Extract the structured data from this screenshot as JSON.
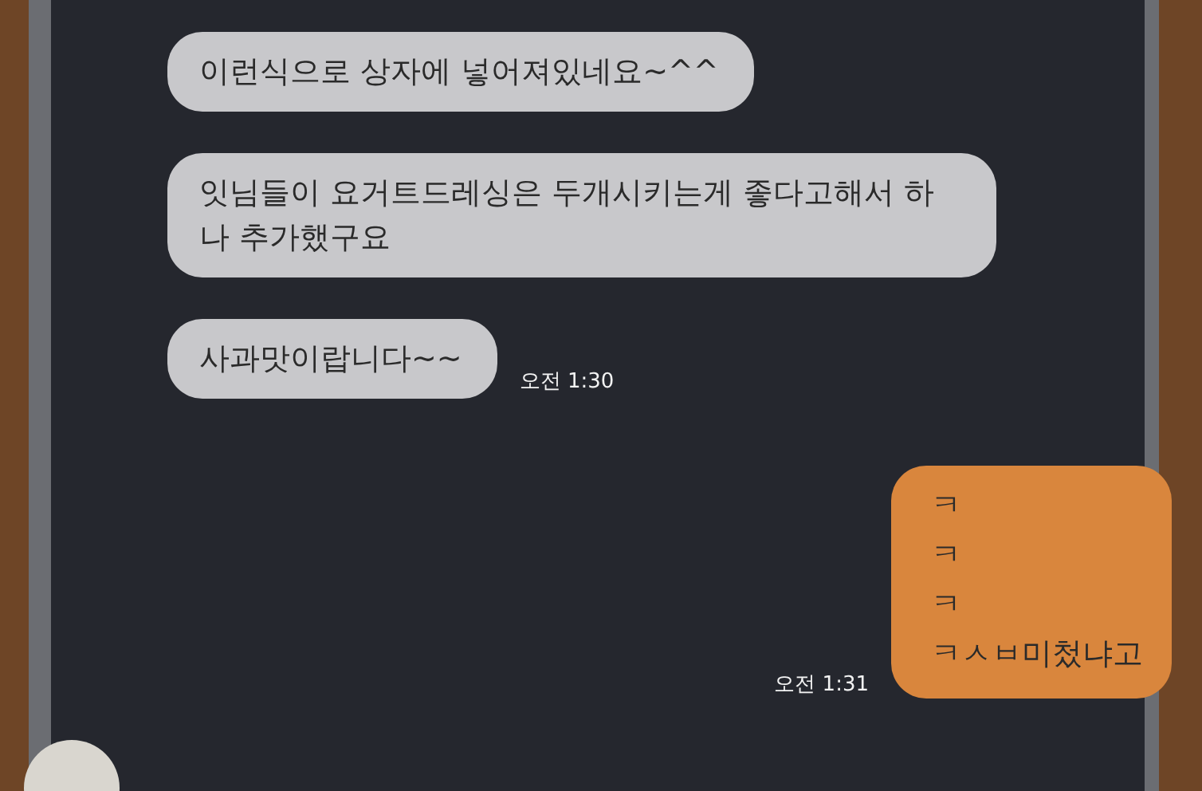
{
  "messages": [
    {
      "kind": "received",
      "lines": [
        "이런식으로 상자에 넣어져있네요~^^"
      ]
    },
    {
      "kind": "received",
      "lines": [
        "잇님들이 요거트드레싱은 두개시키는게 좋다고해서 하나 추가했구요"
      ]
    },
    {
      "kind": "received",
      "lines": [
        "사과맛이랍니다~~"
      ],
      "time": "오전 1:30"
    },
    {
      "kind": "sent",
      "lines": [
        "ㅋ",
        "ㅋ",
        "ㅋ",
        "ㅋㅅㅂ미첬냐고"
      ],
      "time": "오전 1:31"
    }
  ]
}
